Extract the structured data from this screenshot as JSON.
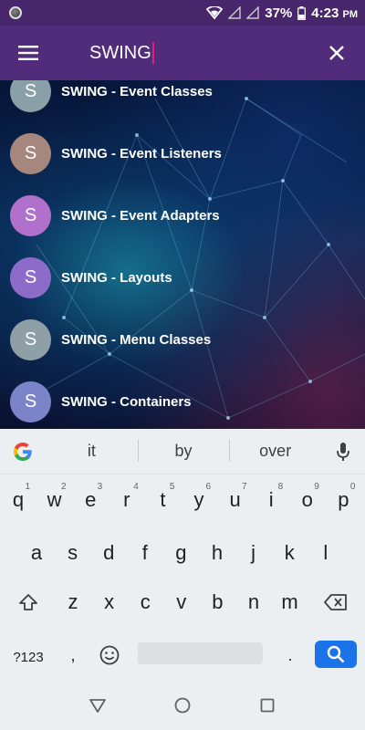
{
  "status": {
    "battery": "37%",
    "time": "4:23",
    "ampm": "PM"
  },
  "toolbar": {
    "query": "SWING",
    "menu_icon": "hamburger-icon",
    "close_icon": "close-icon"
  },
  "results": [
    {
      "letter": "S",
      "title": "SWING - Event Classes",
      "color": "#8aa0a9"
    },
    {
      "letter": "S",
      "title": "SWING - Event Listeners",
      "color": "#a5877d"
    },
    {
      "letter": "S",
      "title": "SWING - Event Adapters",
      "color": "#b170cc"
    },
    {
      "letter": "S",
      "title": "SWING - Layouts",
      "color": "#8d6cc9"
    },
    {
      "letter": "S",
      "title": "SWING - Menu Classes",
      "color": "#8f9fa6"
    },
    {
      "letter": "S",
      "title": "SWING - Containers",
      "color": "#7b84c9"
    }
  ],
  "keyboard": {
    "suggestions": [
      "it",
      "by",
      "over"
    ],
    "row1": [
      {
        "k": "q",
        "h": "1"
      },
      {
        "k": "w",
        "h": "2"
      },
      {
        "k": "e",
        "h": "3"
      },
      {
        "k": "r",
        "h": "4"
      },
      {
        "k": "t",
        "h": "5"
      },
      {
        "k": "y",
        "h": "6"
      },
      {
        "k": "u",
        "h": "7"
      },
      {
        "k": "i",
        "h": "8"
      },
      {
        "k": "o",
        "h": "9"
      },
      {
        "k": "p",
        "h": "0"
      }
    ],
    "row2": [
      "a",
      "s",
      "d",
      "f",
      "g",
      "h",
      "j",
      "k",
      "l"
    ],
    "row3": [
      "z",
      "x",
      "c",
      "v",
      "b",
      "n",
      "m"
    ],
    "symbols_label": "?123",
    "comma": ",",
    "period": "."
  }
}
